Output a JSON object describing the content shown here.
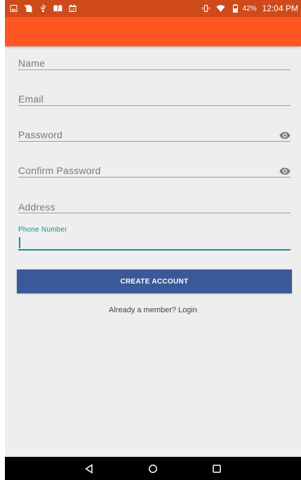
{
  "status_bar": {
    "left_icons": [
      "gallery-icon",
      "no-sim-icon",
      "usb-icon",
      "book-icon",
      "calendar-icon"
    ],
    "right_icons": [
      "vibrate-icon",
      "wifi-icon",
      "battery-icon"
    ],
    "battery_percent": "42%",
    "time": "12:04 PM"
  },
  "form": {
    "name_label": "Name",
    "email_label": "Email",
    "password_label": "Password",
    "confirm_password_label": "Confirm Password",
    "address_label": "Address",
    "phone_label": "Phone Number",
    "phone_value": ""
  },
  "create_button_label": "CREATE ACCOUNT",
  "login_link_text": "Already a member? Login",
  "nav_bar": {
    "back": "back-icon",
    "home": "home-icon",
    "recents": "recents-icon"
  },
  "colors": {
    "app_bar": "#ff5722",
    "status_bar": "#cf4a1b",
    "button": "#3b5998",
    "accent": "#1b8f8f",
    "background": "#eeeeee"
  }
}
